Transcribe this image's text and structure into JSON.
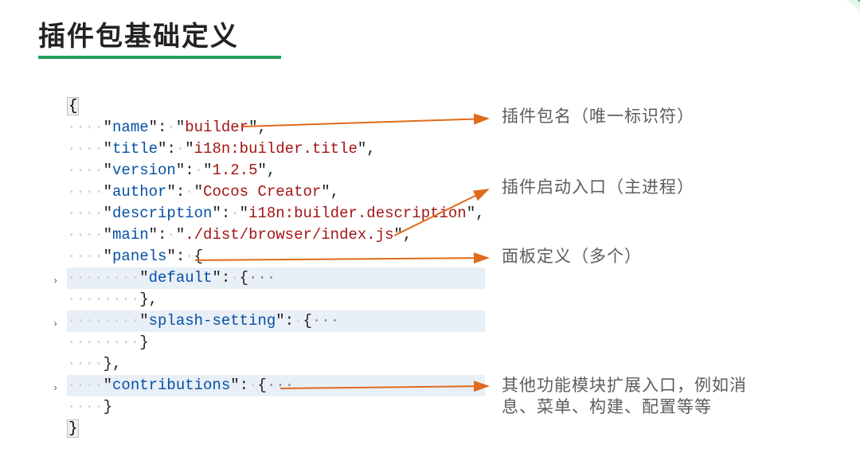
{
  "title": "插件包基础定义",
  "code": {
    "open_brace": "{",
    "close_brace": "}",
    "dots4": "····",
    "dots8": "········",
    "name_key": "name",
    "name_val": "builder",
    "title_key": "title",
    "title_val": "i18n:builder.title",
    "version_key": "version",
    "version_val": "1.2.5",
    "author_key": "author",
    "author_val": "Cocos Creator",
    "description_key": "description",
    "description_val": "i18n:builder.description",
    "main_key": "main",
    "main_val": "./dist/browser/index.js",
    "panels_key": "panels",
    "default_key": "default",
    "splash_key": "splash-setting",
    "contrib_key": "contributions",
    "ellipsis": "···",
    "caret": "›"
  },
  "annotations": {
    "a1": "插件包名（唯一标识符）",
    "a2": "插件启动入口（主进程）",
    "a3": "面板定义（多个）",
    "a4": "其他功能模块扩展入口，例如消息、菜单、构建、配置等等"
  }
}
